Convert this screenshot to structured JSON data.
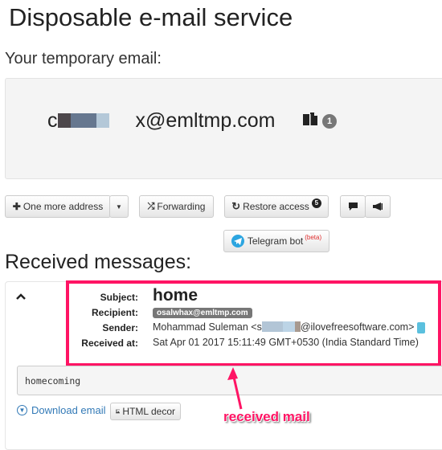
{
  "header": {
    "title": "Disposable e-mail service",
    "subtitle": "Your temporary email:"
  },
  "email": {
    "prefix_visible": "c",
    "suffix": "x@emltmp.com",
    "copy_icon": "copy-icon",
    "count": "1"
  },
  "toolbar": {
    "one_more_address": "One more address",
    "forwarding": "Forwarding",
    "restore_access": "Restore access",
    "restore_badge": "5",
    "telegram_bot": "Telegram bot",
    "telegram_beta": "(beta)"
  },
  "messages": {
    "title": "Received messages:",
    "items": [
      {
        "labels": {
          "subject": "Subject:",
          "recipient": "Recipient:",
          "sender": "Sender:",
          "received_at": "Received at:"
        },
        "subject": "home",
        "recipient": "osalwhax@emltmp.com",
        "sender_name": "Mohammad Suleman <s",
        "sender_domain": "@ilovefreesoftware.com>",
        "received_at": "Sat Apr 01 2017 15:11:49 GMT+0530 (India Standard Time)",
        "body": "homecoming",
        "download_label": "Download email",
        "html_decor_label": "HTML decor"
      }
    ]
  },
  "annotation": {
    "label": "received mail",
    "color": "#ff1464"
  }
}
